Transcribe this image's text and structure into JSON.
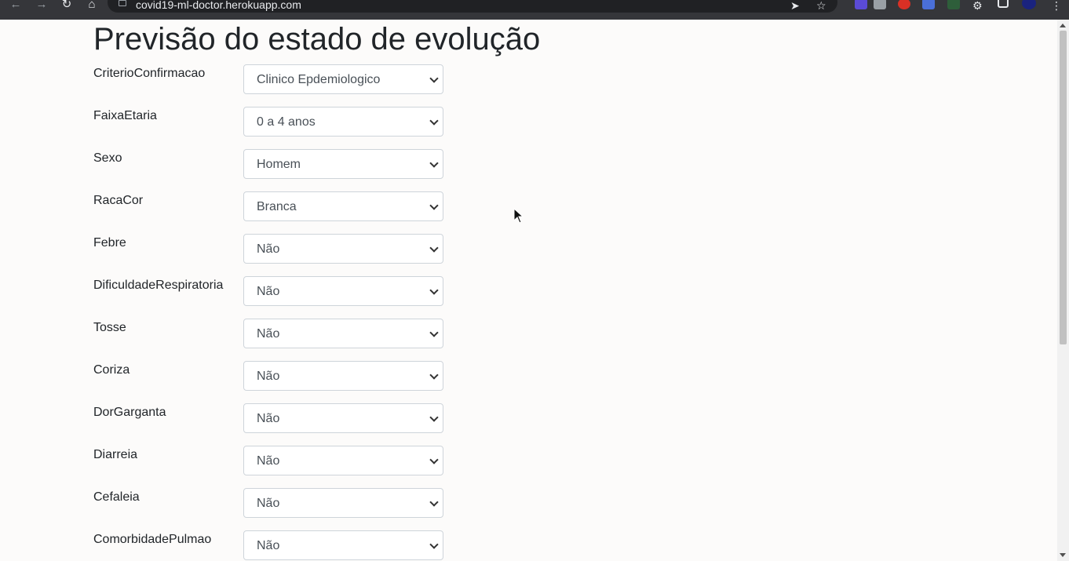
{
  "browser": {
    "url": "covid19-ml-doctor.herokuapp.com"
  },
  "page": {
    "title": "Previsão do estado de evolução"
  },
  "form": {
    "fields": [
      {
        "label": "CriterioConfirmacao",
        "value": "Clinico Epdemiologico"
      },
      {
        "label": "FaixaEtaria",
        "value": "0 a 4 anos"
      },
      {
        "label": "Sexo",
        "value": "Homem"
      },
      {
        "label": "RacaCor",
        "value": "Branca"
      },
      {
        "label": "Febre",
        "value": "Não"
      },
      {
        "label": "DificuldadeRespiratoria",
        "value": "Não"
      },
      {
        "label": "Tosse",
        "value": "Não"
      },
      {
        "label": "Coriza",
        "value": "Não"
      },
      {
        "label": "DorGarganta",
        "value": "Não"
      },
      {
        "label": "Diarreia",
        "value": "Não"
      },
      {
        "label": "Cefaleia",
        "value": "Não"
      },
      {
        "label": "ComorbidadePulmao",
        "value": "Não"
      }
    ]
  }
}
